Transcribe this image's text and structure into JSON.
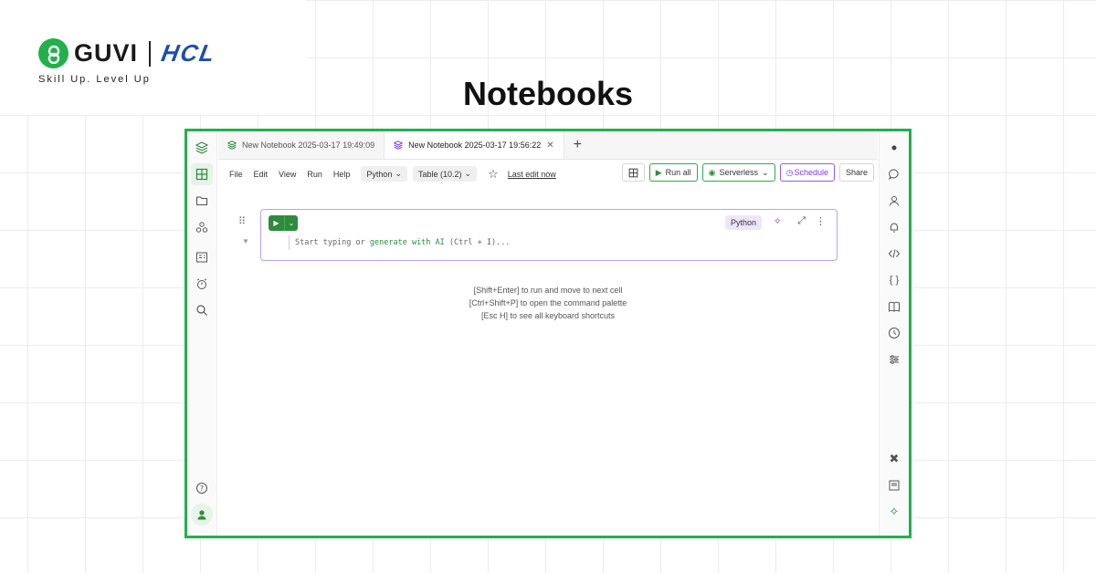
{
  "brand": {
    "name": "GUVI",
    "partner": "HCL",
    "tagline": "Skill Up. Level Up"
  },
  "headline": "Notebooks",
  "tabs": [
    {
      "label": "New Notebook 2025-03-17 19:49:09",
      "active": false
    },
    {
      "label": "New Notebook 2025-03-17 19:56:22",
      "active": true,
      "close": "✕"
    }
  ],
  "tab_add": "+",
  "menu": {
    "items": [
      "File",
      "Edit",
      "View",
      "Run",
      "Help"
    ],
    "language": "Python",
    "table": "Table (10.2)",
    "last_edit": "Last edit now"
  },
  "toolbar": {
    "run_all": "Run all",
    "compute": "Serverless",
    "schedule": "Schedule",
    "share": "Share"
  },
  "cell": {
    "language": "Python",
    "placeholder_start": "Start typing or ",
    "placeholder_link": "generate with AI",
    "placeholder_end": " (Ctrl + I)..."
  },
  "hints": [
    {
      "key": "[Shift+Enter]",
      "text": " to run and move to next cell"
    },
    {
      "key": "[Ctrl+Shift+P]",
      "text": " to open the command palette"
    },
    {
      "key": "[Esc H]",
      "text": " to see all keyboard shortcuts"
    }
  ],
  "colors": {
    "brand_green": "#22b04b",
    "hcl_blue": "#1d4fa8",
    "run_green": "#2e8b3e",
    "cell_border": "#b9a3e8"
  }
}
